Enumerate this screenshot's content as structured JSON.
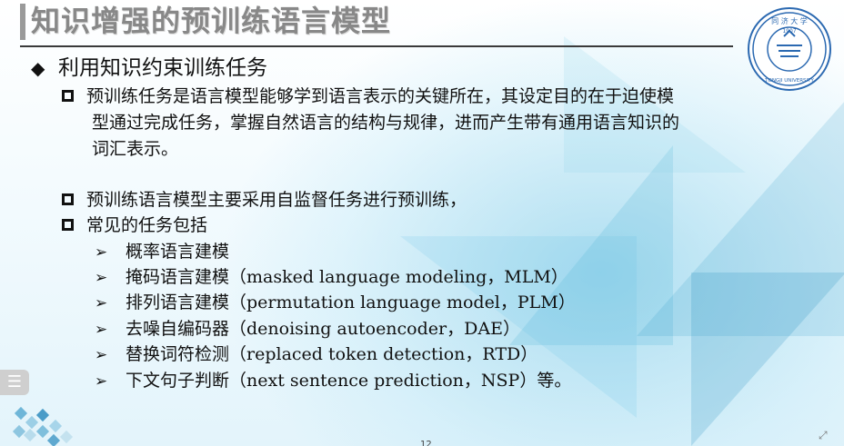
{
  "slide": {
    "title": "知识增强的预训练语言模型",
    "heading": "利用知识约束训练任务",
    "heading_marker": "◆",
    "para1_line1": "预训练任务是语言模型能够学到语言表示的关键所在，其设定目的在于迫使模",
    "para1_line2": "型通过完成任务，掌握自然语言的结构与规律，进而产生带有通用语言知识的",
    "para1_line3": "词汇表示。",
    "para2": "预训练语言模型主要采用自监督任务进行预训练，",
    "para3": "常见的任务包括",
    "sub_marker": "➢",
    "tasks": [
      "概率语言建模",
      "掩码语言建模（masked language modeling，MLM）",
      "排列语言建模（permutation language model，PLM）",
      "去噪自编码器（denoising autoencoder，DAE）",
      "替换词符检测（replaced token detection，RTD）",
      "下文句子判断（next sentence prediction，NSP）等。"
    ],
    "page_number": "12"
  },
  "controls": {
    "menu_glyph": "☰",
    "expand_glyph": "⤢"
  },
  "logo": {
    "icon": "university-seal-icon",
    "year": "1907",
    "motto": "TONGJI UNIVERSITY",
    "color": "#2b69b1"
  },
  "colors": {
    "title": "#888888",
    "text": "#111111",
    "accent": "#2b69b1"
  }
}
